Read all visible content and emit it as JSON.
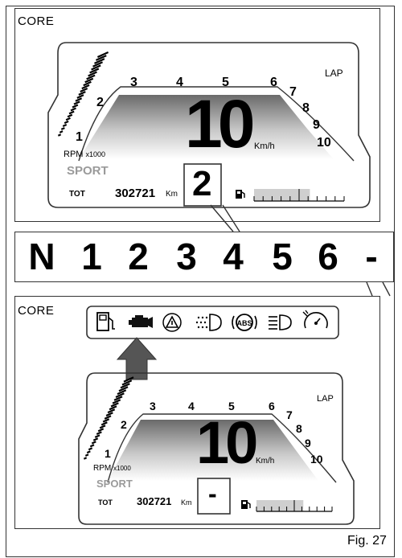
{
  "figure_label": "Fig. 27",
  "panel_top": {
    "title": "CORE",
    "rpm_numbers": [
      "1",
      "2",
      "3",
      "4",
      "5",
      "6",
      "7",
      "8",
      "9",
      "10"
    ],
    "lap": "LAP",
    "speed": "10",
    "speed_unit": "Km/h",
    "rpm_label": "RPM",
    "rpm_multiplier": "x1000",
    "mode": "SPORT",
    "odo_label": "TOT",
    "odo_value": "302721",
    "odo_unit": "Km",
    "gear": "2"
  },
  "gear_strip": [
    "N",
    "1",
    "2",
    "3",
    "4",
    "5",
    "6",
    "-"
  ],
  "panel_bottom": {
    "title": "CORE",
    "warning_icons": [
      "fuel-reserve-icon",
      "engine-check-icon",
      "general-warning-icon",
      "side-light-icon",
      "abs-icon",
      "high-beam-icon",
      "service-icon"
    ],
    "abs_text": "ABS",
    "rpm_numbers": [
      "1",
      "2",
      "3",
      "4",
      "5",
      "6",
      "7",
      "8",
      "9",
      "10"
    ],
    "lap": "LAP",
    "speed": "10",
    "speed_unit": "Km/h",
    "rpm_label": "RPM",
    "rpm_multiplier": "x1000",
    "mode": "SPORT",
    "odo_label": "TOT",
    "odo_value": "302721",
    "odo_unit": "Km",
    "gear": "-"
  },
  "colors": {
    "line": "#333333",
    "mode_grey": "#9a9a9a",
    "bar_fill": "#cfcfcf",
    "arrow": "#555555"
  }
}
